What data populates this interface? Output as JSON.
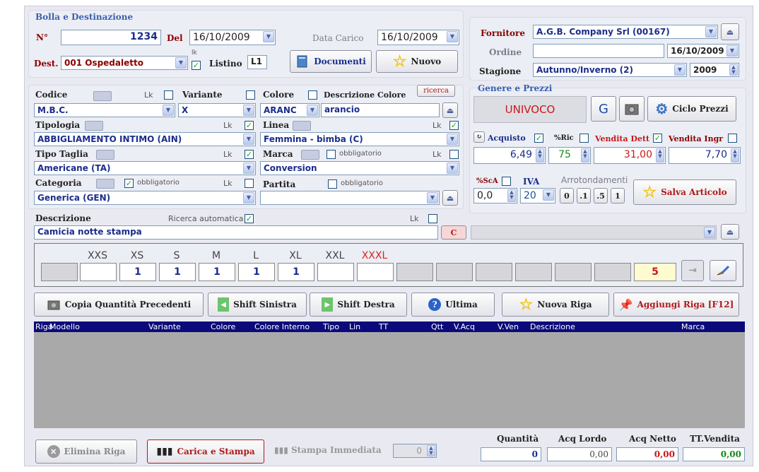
{
  "bolla": {
    "title": "Bolla e Destinazione",
    "n_label": "N°",
    "n_value": "1234",
    "del_label": "Del",
    "del_value": "16/10/2009",
    "data_carico_label": "Data Carico",
    "data_carico_value": "16/10/2009",
    "dest_label": "Dest.",
    "dest_value": "001 Ospedaletto",
    "lk_small": "lk",
    "listino_label": "Listino",
    "listino_value": "L1",
    "documenti_label": "Documenti",
    "nuovo_label": "Nuovo"
  },
  "fornitore": {
    "fornitore_label": "Fornitore",
    "fornitore_value": "A.G.B. Company Srl (00167)",
    "ordine_label": "Ordine",
    "ordine_value": "",
    "ordine_date": "16/10/2009",
    "stagione_label": "Stagione",
    "stagione_value": "Autunno/Inverno (2)",
    "anno_value": "2009"
  },
  "articolo": {
    "codice_label": "Codice",
    "lk": "Lk",
    "variante_label": "Variante",
    "colore_label": "Colore",
    "desc_colore_label": "Descrizione Colore",
    "ricerca_label": "ricerca",
    "codice_value": "M.B.C.",
    "variante_value": "X",
    "colore_value": "ARANC",
    "desc_colore_value": "arancio",
    "tipologia_label": "Tipologia",
    "tipologia_value": "ABBIGLIAMENTO INTIMO (AIN)",
    "linea_label": "Linea",
    "linea_value": "Femmina - bimba (C)",
    "tipo_taglia_label": "Tipo Taglia",
    "tipo_taglia_value": "Americane (TA)",
    "marca_label": "Marca",
    "obbligatorio": "obbligatorio",
    "marca_value": "Conversion",
    "categoria_label": "Categoria",
    "categoria_value": "Generica (GEN)",
    "partita_label": "Partita",
    "partita_value": "",
    "descrizione_label": "Descrizione",
    "ricerca_auto_label": "Ricerca automatica",
    "descrizione_value": "Camicia notte stampa",
    "c_button": "C"
  },
  "genere": {
    "title": "Genere e Prezzi",
    "univoco": "UNIVOCO",
    "g_button": "G",
    "ciclo_prezzi_label": "Ciclo Prezzi",
    "acquisto_label": "Acquisto",
    "ric_label": "%Ric",
    "vendita_dett_label": "Vendita Dett",
    "vendita_ingr_label": "Vendita Ingr",
    "acquisto_value": "6,49",
    "ric_value": "75",
    "vendita_dett_value": "31,00",
    "vendita_ingr_value": "7,70",
    "sca_label": "%ScA",
    "iva_label": "IVA",
    "arrotondamenti_label": "Arrotondamenti",
    "sca_value": "0,0",
    "iva_value": "20",
    "arr_0": "0",
    ".1": ".1",
    "arr_1": ".1",
    "arr_5": ".5",
    "arr_one": "1",
    "salva_label": "Salva Articolo"
  },
  "taglie": {
    "sizes": [
      "XXS",
      "XS",
      "S",
      "M",
      "L",
      "XL",
      "XXL",
      "XXXL"
    ],
    "quantities": [
      "1",
      "1",
      "1",
      "1",
      "1"
    ],
    "total": "5"
  },
  "actions": {
    "copia": "Copia Quantità Precedenti",
    "shift_sx": "Shift Sinistra",
    "shift_dx": "Shift Destra",
    "ultima": "Ultima",
    "nuova_riga": "Nuova Riga",
    "aggiungi": "Aggiungi Riga [F12]"
  },
  "grid": {
    "columns": [
      "Riga",
      "Modello",
      "Variante",
      "Colore",
      "Colore Interno",
      "Tipo",
      "Lin",
      "TT",
      "Qtt",
      "V.Acq",
      "V.Ven",
      "Descrizione",
      "Marca"
    ]
  },
  "footer": {
    "elimina": "Elimina Riga",
    "carica_stampa": "Carica e Stampa",
    "stampa_immediata": "Stampa Immediata",
    "stampa_value": "0",
    "quantita_label": "Quantità",
    "quantita_value": "0",
    "acq_lordo_label": "Acq Lordo",
    "acq_lordo_value": "0,00",
    "acq_netto_label": "Acq Netto",
    "acq_netto_value": "0,00",
    "tt_vendita_label": "TT.Vendita",
    "tt_vendita_value": "0,00"
  },
  "colors": {
    "accent": "#3b5fae",
    "header": "#0a0a7a",
    "red": "#b01818",
    "green": "#1a8a1a"
  }
}
